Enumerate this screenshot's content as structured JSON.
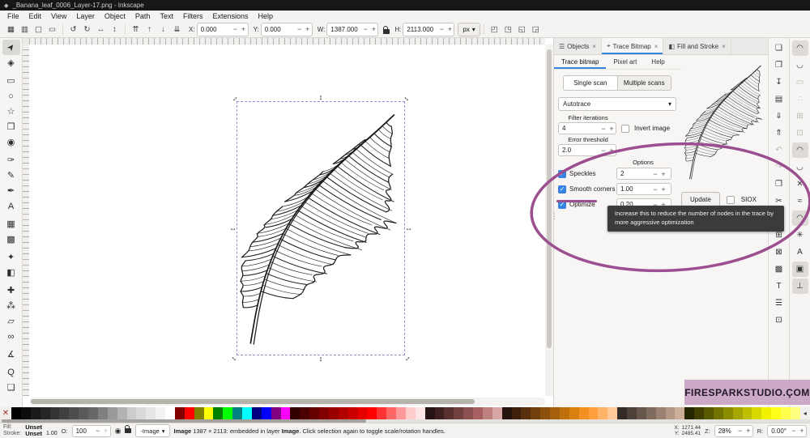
{
  "window": {
    "title": "_Banana_leaf_0006_Layer-17.png - Inkscape",
    "logo_glyph": "◆"
  },
  "menubar": {
    "items": [
      "File",
      "Edit",
      "View",
      "Layer",
      "Object",
      "Path",
      "Text",
      "Filters",
      "Extensions",
      "Help"
    ]
  },
  "ui": {
    "minus": "−",
    "plus": "+",
    "dropdown_arrow": "▾",
    "close": "×",
    "check": "✓",
    "h_arrow": "↔",
    "v_arrow": "↕",
    "splitter_dots": "⋮",
    "palette_arrow": "◂",
    "eye": "◉",
    "remove_color": "✕"
  },
  "toolbar": {
    "select_buttons": [
      {
        "name": "select-all-button",
        "glyph": "▦"
      },
      {
        "name": "select-all-layers-button",
        "glyph": "▥"
      },
      {
        "name": "deselect-button",
        "glyph": "▢"
      },
      {
        "name": "selection-touch-button",
        "glyph": "▭"
      }
    ],
    "transform_buttons": [
      {
        "name": "rotate-ccw-button",
        "glyph": "↺"
      },
      {
        "name": "rotate-cw-button",
        "glyph": "↻"
      },
      {
        "name": "flip-horizontal-button",
        "glyph": "↔"
      },
      {
        "name": "flip-vertical-button",
        "glyph": "↕"
      }
    ],
    "zorder_buttons": [
      {
        "name": "raise-to-top-button",
        "glyph": "⇈"
      },
      {
        "name": "raise-button",
        "glyph": "↑"
      },
      {
        "name": "lower-button",
        "glyph": "↓"
      },
      {
        "name": "lower-to-bottom-button",
        "glyph": "⇊"
      }
    ],
    "option_buttons": [
      {
        "name": "transform-stroke-toggle",
        "glyph": "◰"
      },
      {
        "name": "transform-corners-toggle",
        "glyph": "◳"
      },
      {
        "name": "transform-gradient-toggle",
        "glyph": "◱"
      },
      {
        "name": "transform-pattern-toggle",
        "glyph": "◲"
      }
    ],
    "x_label": "X:",
    "x_value": "0.000",
    "y_label": "Y:",
    "y_value": "0.000",
    "w_label": "W:",
    "w_value": "1387.000",
    "h_label": "H:",
    "h_value": "2113.000",
    "unit": "px"
  },
  "toolbox": {
    "tools": [
      {
        "name": "selector-tool",
        "glyph": "➤",
        "active": true,
        "rot": true
      },
      {
        "name": "node-tool",
        "glyph": "◈"
      },
      {
        "name": "rectangle-tool",
        "glyph": "▭",
        "gap": true
      },
      {
        "name": "ellipse-tool",
        "glyph": "○"
      },
      {
        "name": "star-tool",
        "glyph": "☆"
      },
      {
        "name": "box3d-tool",
        "glyph": "❒"
      },
      {
        "name": "spiral-tool",
        "glyph": "◉"
      },
      {
        "name": "pen-tool",
        "glyph": "✑",
        "gap": true
      },
      {
        "name": "pencil-tool",
        "glyph": "✎"
      },
      {
        "name": "calligraphy-tool",
        "glyph": "✒"
      },
      {
        "name": "text-tool",
        "glyph": "A"
      },
      {
        "name": "gradient-tool",
        "glyph": "▦",
        "gap": true
      },
      {
        "name": "mesh-tool",
        "glyph": "▩"
      },
      {
        "name": "dropper-tool",
        "glyph": "✦",
        "gap": true
      },
      {
        "name": "paint-bucket-tool",
        "glyph": "◧"
      },
      {
        "name": "tweak-tool",
        "glyph": "✚",
        "gap": true
      },
      {
        "name": "spray-tool",
        "glyph": "⁂"
      },
      {
        "name": "eraser-tool",
        "glyph": "▱"
      },
      {
        "name": "connector-tool",
        "glyph": "∞"
      },
      {
        "name": "measure-tool",
        "glyph": "∡",
        "gap": true
      },
      {
        "name": "zoom-tool",
        "glyph": "Q",
        "gap": true
      },
      {
        "name": "pages-tool",
        "glyph": "❏"
      }
    ]
  },
  "commandbar": {
    "items": [
      {
        "name": "new-document-button",
        "glyph": "❏"
      },
      {
        "name": "open-file-button",
        "glyph": "❒"
      },
      {
        "name": "save-button",
        "glyph": "↧"
      },
      {
        "name": "print-button",
        "glyph": "▤"
      },
      {
        "name": "import-button",
        "glyph": "⇓"
      },
      {
        "name": "export-button",
        "glyph": "⇑"
      },
      {
        "name": "undo-button",
        "glyph": "↶",
        "muted": true
      },
      {
        "name": "redo-button",
        "glyph": "↷",
        "muted": true
      },
      {
        "name": "copy-button",
        "glyph": "❐"
      },
      {
        "name": "cut-button",
        "glyph": "✂"
      },
      {
        "name": "paste-button",
        "glyph": "▣"
      },
      {
        "name": "duplicate-button",
        "glyph": "⊞"
      },
      {
        "name": "clone-button",
        "glyph": "⊠"
      },
      {
        "name": "group-button",
        "glyph": "▩"
      },
      {
        "name": "text-dialog-button",
        "glyph": "T"
      },
      {
        "name": "align-dialog-button",
        "glyph": "☰"
      },
      {
        "name": "zoom-drawing-button",
        "glyph": "⊡"
      }
    ]
  },
  "snapbar": {
    "items": [
      {
        "name": "snap-master-toggle",
        "glyph": "◠",
        "active": true
      },
      {
        "name": "snap-bbox-toggle",
        "glyph": "◡"
      },
      {
        "name": "snap-bbox-edges-toggle",
        "glyph": "▭",
        "muted": true
      },
      {
        "name": "snap-bbox-corners-toggle",
        "glyph": "∴",
        "muted": true
      },
      {
        "name": "snap-bbox-edge-mid-toggle",
        "glyph": "⊞",
        "muted": true
      },
      {
        "name": "snap-bbox-centers-toggle",
        "glyph": "⊡",
        "muted": true
      },
      {
        "name": "snap-nodes-toggle",
        "glyph": "◠",
        "active": true
      },
      {
        "name": "snap-path-toggle",
        "glyph": "◡"
      },
      {
        "name": "snap-path-intersections-toggle",
        "glyph": "✕"
      },
      {
        "name": "snap-smooth-nodes-toggle",
        "glyph": "≈"
      },
      {
        "name": "snap-midpoints-toggle",
        "glyph": "◠",
        "active": true
      },
      {
        "name": "snap-others-toggle",
        "glyph": "✳"
      },
      {
        "name": "snap-text-toggle",
        "glyph": "A"
      },
      {
        "name": "snap-page-border-toggle",
        "glyph": "▣",
        "active": true
      },
      {
        "name": "snap-grid-guide-toggle",
        "glyph": "⊥",
        "active": true
      }
    ]
  },
  "dock": {
    "tabs": [
      {
        "label": "Objects",
        "icon_name": "objects-icon",
        "icon": "☰",
        "active": false
      },
      {
        "label": "Trace Bitmap",
        "icon_name": "trace-bitmap-icon",
        "icon": "⌖",
        "active": true
      },
      {
        "label": "Fill and Stroke",
        "icon_name": "fill-stroke-icon",
        "icon": "◧",
        "active": false
      }
    ],
    "subtabs": [
      {
        "label": "Trace bitmap",
        "active": true
      },
      {
        "label": "Pixel art",
        "active": false
      },
      {
        "label": "Help",
        "active": false
      }
    ],
    "scan_modes": [
      {
        "label": "Single scan",
        "active": true
      },
      {
        "label": "Multiple scans",
        "active": false
      }
    ],
    "detection_mode": "Autotrace",
    "filter_iterations_label": "Filter iterations",
    "filter_iterations_value": "4",
    "invert_label": "Invert image",
    "error_threshold_label": "Error threshold",
    "error_threshold_value": "2.0",
    "options_label": "Options",
    "options": [
      {
        "label": "Speckles",
        "value": "2",
        "checked": true
      },
      {
        "label": "Smooth corners",
        "value": "1.00",
        "checked": true
      },
      {
        "label": "Optimize",
        "value": "0.20",
        "checked": true
      }
    ],
    "update_label": "Update",
    "siox_label": "SIOX"
  },
  "tooltip": {
    "text": "Increase this to reduce the number of nodes in the trace by more aggressive optimization"
  },
  "watermark": {
    "text": "FIRESPARKSTUDIO.ÇOM"
  },
  "statusbar": {
    "fill_label": "Fill:",
    "fill_value": "Unset",
    "stroke_label": "Stroke:",
    "stroke_value": "Unset",
    "stroke_width": "1.00",
    "opacity_label": "O:",
    "opacity_value": "100",
    "layer_indicator": "-Image",
    "msg_b1": "Image",
    "msg_m": " 1387 × 2113: embedded in layer ",
    "msg_b2": "Image",
    "msg_e": ". Click selection again to toggle scale/rotation handles.",
    "x_label": "X:",
    "x_value": "1271.44",
    "y_label": "Y:",
    "y_value": "2485.41",
    "z_label": "Z:",
    "zoom_value": "28%",
    "r_label": "R:",
    "rotation_value": "0.00°"
  },
  "colors": {
    "accent": "#3584e4",
    "annotation": "#9c4f90",
    "tooltip_bg": "#3b3b3b",
    "watermark_bg": "#c9a2c4",
    "ink": "#1c1c1c"
  },
  "palette": {
    "colors": [
      "#000000",
      "#0d0d0d",
      "#1a1a1a",
      "#262626",
      "#333333",
      "#404040",
      "#4d4d4d",
      "#5a5a5a",
      "#666666",
      "#808080",
      "#999999",
      "#b3b3b3",
      "#cccccc",
      "#d9d9d9",
      "#e6e6e6",
      "#f2f2f2",
      "#ffffff",
      "#800000",
      "#ff0000",
      "#808000",
      "#ffff00",
      "#008000",
      "#00ff00",
      "#008080",
      "#00ffff",
      "#000080",
      "#0000ff",
      "#800080",
      "#ff00ff",
      "#330000",
      "#4d0000",
      "#660000",
      "#800000",
      "#990000",
      "#b30000",
      "#cc0000",
      "#e60000",
      "#ff0000",
      "#ff3333",
      "#ff6666",
      "#ff9999",
      "#ffcccc",
      "#ffe6e6",
      "#261313",
      "#3f2020",
      "#593030",
      "#734040",
      "#8c5050",
      "#a66060",
      "#bf8080",
      "#d9a6a6",
      "#26130d",
      "#40200d",
      "#59300d",
      "#73400d",
      "#8c500d",
      "#a6600d",
      "#bf700d",
      "#d98010",
      "#f29022",
      "#ff9f3d",
      "#ffb366",
      "#ffc999",
      "#332b26",
      "#4d4139",
      "#66564c",
      "#806c5f",
      "#998272",
      "#b39886",
      "#ccae99",
      "#262600",
      "#404000",
      "#595900",
      "#737300",
      "#8c8c00",
      "#a6a600",
      "#bfbf00",
      "#d9d900",
      "#f2f200",
      "#ffff1a",
      "#ffff4d",
      "#ffff80"
    ]
  }
}
